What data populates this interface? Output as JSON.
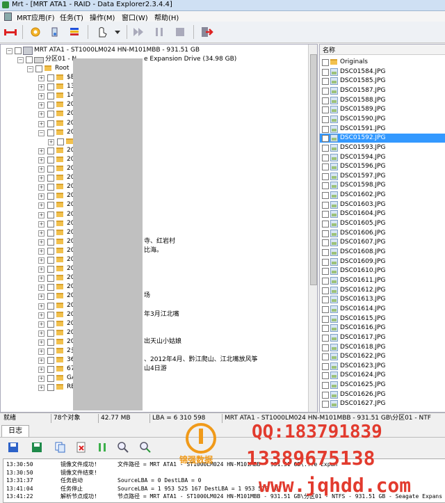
{
  "window": {
    "title": "Mrt - [MRT ATA1 - RAID - Data Explorer2.3.4.4]"
  },
  "menu": [
    "MRT应用(F)",
    "任务(T)",
    "操作(M)",
    "窗口(W)",
    "帮助(H)"
  ],
  "toolbar": {
    "icons": [
      "raid-icon",
      "gear-icon",
      "tools-icon",
      "palette-icon",
      "pointer-icon",
      "play-icon",
      "pause-icon",
      "stop-icon",
      "exit-icon"
    ]
  },
  "tree": {
    "device_label": "MRT ATA1 - ST1000LM024 HN-M101MBB - 931.51 GB",
    "partition_prefix": "分区01 - N",
    "partition_suffix": "e Expansion Drive (34.98 GB)",
    "root_label": "Root",
    "folders": [
      "$E",
      "13",
      "14",
      "20",
      "20",
      "20",
      "20",
      "",
      "20",
      "20",
      "20",
      "20",
      "20",
      "20",
      "20",
      "20",
      "20",
      "20",
      "20",
      "20",
      "20",
      "20",
      "20",
      "20",
      "20",
      "20",
      "20",
      "20",
      "20",
      "20",
      "2多",
      "36",
      "67",
      "GA",
      "RE"
    ],
    "right_fragments": [
      {
        "row": 18,
        "text": "寺、红岩村"
      },
      {
        "row": 19,
        "text": "比海。"
      },
      {
        "row": 24,
        "text": "场"
      },
      {
        "row": 26,
        "text": "年3月江北嘴"
      },
      {
        "row": 29,
        "text": "出天山小姑娘"
      },
      {
        "row": 31,
        "text": "、2012年4月、黔江爬山、江北嘴放风筝"
      },
      {
        "row": 32,
        "text": "山4日游"
      }
    ]
  },
  "list": {
    "header": "名称",
    "items": [
      "Originals",
      "DSC01584.JPG",
      "DSC01585.JPG",
      "DSC01587.JPG",
      "DSC01588.JPG",
      "DSC01589.JPG",
      "DSC01590.JPG",
      "DSC01591.JPG",
      "DSC01592.JPG",
      "DSC01593.JPG",
      "DSC01594.JPG",
      "DSC01596.JPG",
      "DSC01597.JPG",
      "DSC01598.JPG",
      "DSC01602.JPG",
      "DSC01603.JPG",
      "DSC01604.JPG",
      "DSC01605.JPG",
      "DSC01606.JPG",
      "DSC01607.JPG",
      "DSC01608.JPG",
      "DSC01609.JPG",
      "DSC01610.JPG",
      "DSC01611.JPG",
      "DSC01612.JPG",
      "DSC01613.JPG",
      "DSC01614.JPG",
      "DSC01615.JPG",
      "DSC01616.JPG",
      "DSC01617.JPG",
      "DSC01618.JPG",
      "DSC01622.JPG",
      "DSC01623.JPG",
      "DSC01624.JPG",
      "DSC01625.JPG",
      "DSC01626.JPG",
      "DSC01627.JPG"
    ],
    "selected": "DSC01592.JPG"
  },
  "status": {
    "state": "就绪",
    "objects": "78个对象",
    "size": "42.77 MB",
    "lba": "LBA = 6 310 598",
    "path": "MRT ATA1 - ST1000LM024 HN-M101MBB - 931.51 GB\\分区01 - NTF"
  },
  "log": {
    "tab": "日志",
    "rows": [
      {
        "time": "13:30:50",
        "msg": "镜像文件成功!",
        "detail": "文件路径 = MRT ATA1 - ST1000LM024 HN-M101MBB - 931.51 GB\\...e Expan"
      },
      {
        "time": "13:30:50",
        "msg": "镜像文件结束!",
        "detail": ""
      },
      {
        "time": "13:31:37",
        "msg": "任务启动",
        "detail": "SourceLBA = 0                DestLBA = 0"
      },
      {
        "time": "13:41:04",
        "msg": "任务停止",
        "detail": "SourceLBA = 1 953 525 167    DestLBA = 1 953 525 167"
      },
      {
        "time": "13:41:22",
        "msg": "解析节点成功!",
        "detail": "节点路径 = MRT ATA1 - ST1000LM024 HN-M101MBB - 931.51 GB\\分区01 - NTFS - 931.51 GB - Seagate Expans"
      }
    ]
  },
  "watermark": {
    "qq": "QQ:183791839",
    "phone": "13389675138",
    "url": "www.jqhdd.com",
    "brand": "锦强数据"
  }
}
